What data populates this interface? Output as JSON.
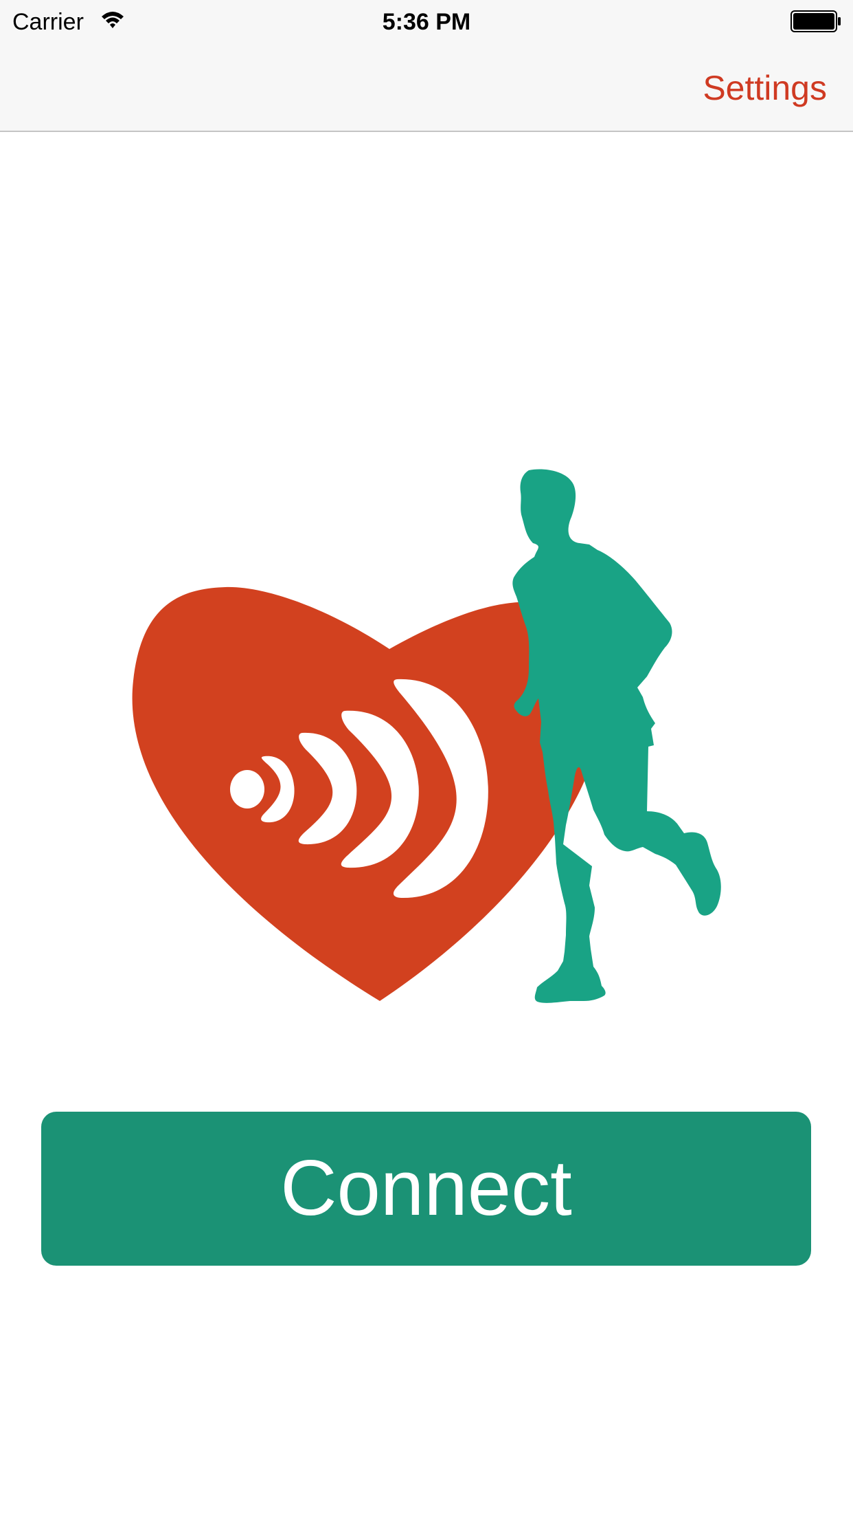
{
  "status_bar": {
    "carrier": "Carrier",
    "time": "5:36 PM",
    "icons": [
      "wifi-icon",
      "battery-icon"
    ]
  },
  "nav_bar": {
    "settings_label": "Settings"
  },
  "logo": {
    "icon": "heart-signal-runner-logo",
    "heart_color": "#d2411f",
    "runner_color": "#19a385"
  },
  "main": {
    "connect_label": "Connect"
  },
  "colors": {
    "accent": "#cf3a22",
    "button": "#1b9275",
    "nav_background": "#f7f7f7"
  }
}
